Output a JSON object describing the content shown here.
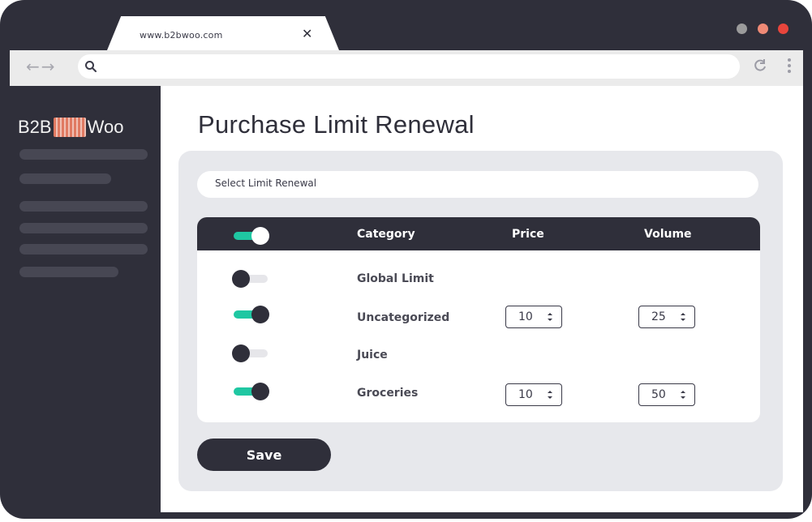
{
  "browser": {
    "tab_url": "www.b2bwoo.com",
    "close_symbol": "✕",
    "nav_arrows": "←→",
    "window_dots": [
      "#9b9b9b",
      "#ef8a76",
      "#e8453c"
    ]
  },
  "sidebar": {
    "logo_left": "B2B",
    "logo_right": "Woo"
  },
  "main": {
    "title": "Purchase Limit Renewal",
    "select_label": "Select Limit Renewal",
    "table": {
      "headers": {
        "category": "Category",
        "price": "Price",
        "volume": "Volume"
      },
      "header_toggle": "on",
      "rows": [
        {
          "category": "Global Limit",
          "enabled": false
        },
        {
          "category": "Uncategorized",
          "enabled": true,
          "price": "10",
          "volume": "25"
        },
        {
          "category": "Juice",
          "enabled": false
        },
        {
          "category": "Groceries",
          "enabled": true,
          "price": "10",
          "volume": "50"
        }
      ]
    },
    "save_label": "Save"
  },
  "colors": {
    "dark": "#2f2f3a",
    "accent": "#1fc7a2",
    "panel": "#e7e8ec"
  }
}
